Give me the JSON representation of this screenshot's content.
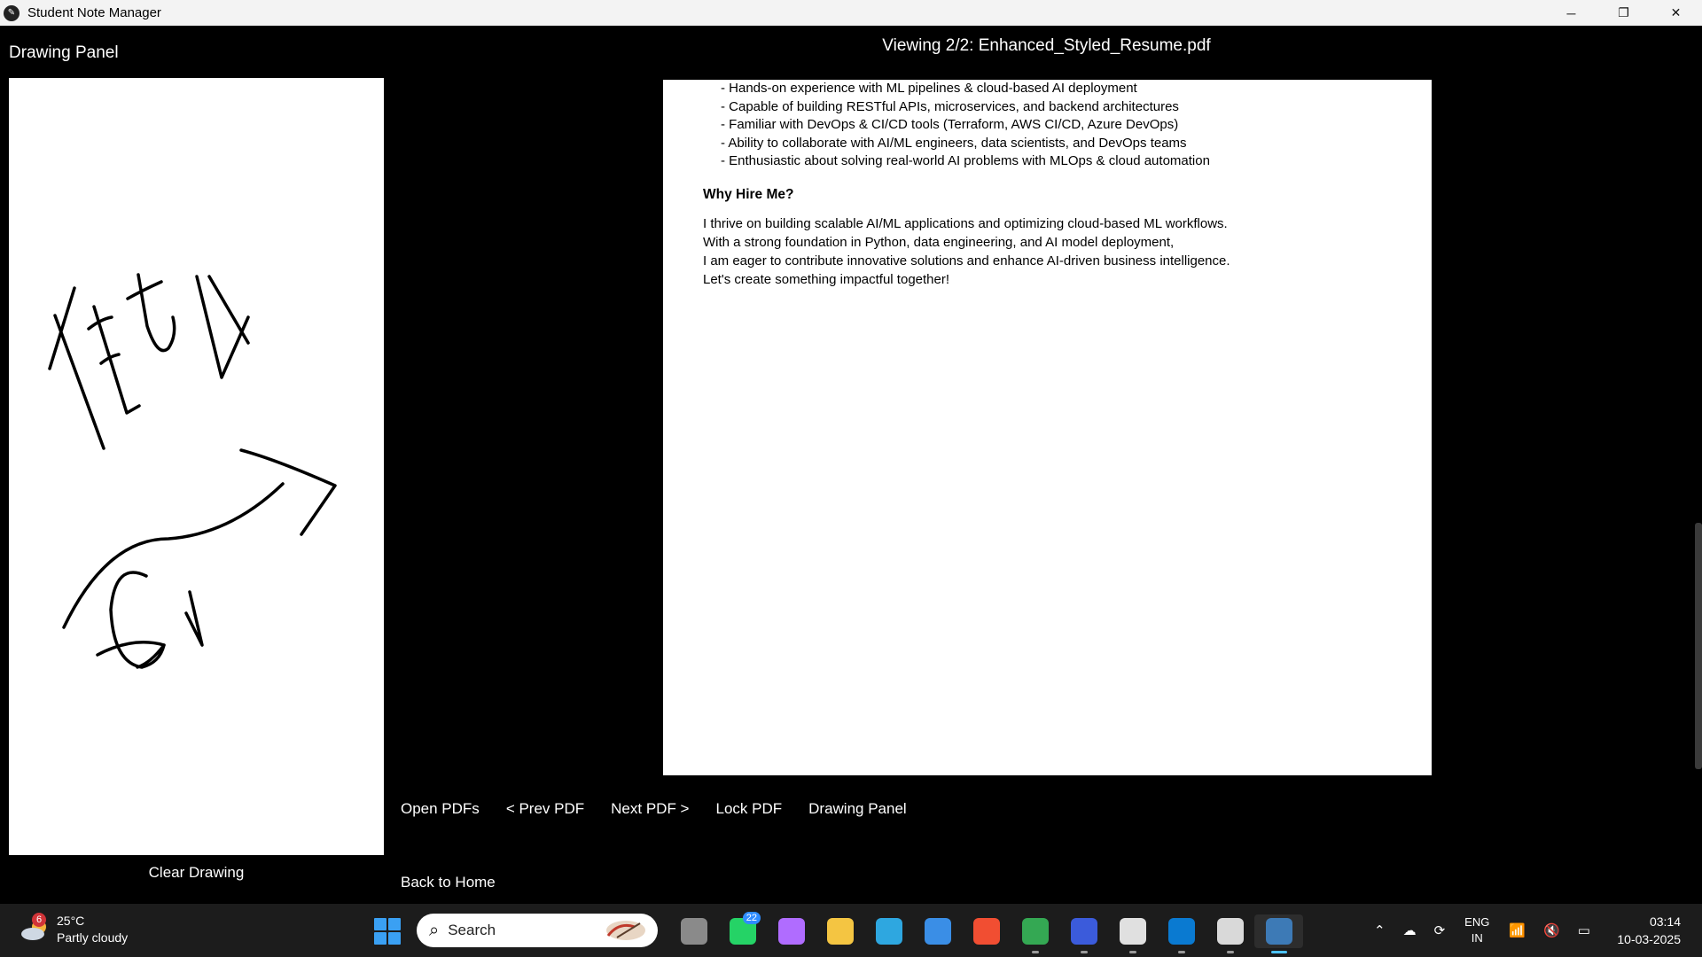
{
  "window": {
    "title": "Student Note Manager",
    "minimize_glyph": "─",
    "maximize_glyph": "❐",
    "close_glyph": "✕"
  },
  "drawing_panel": {
    "heading": "Drawing Panel",
    "clear_button": "Clear Drawing"
  },
  "viewer": {
    "status": "Viewing 2/2: Enhanced_Styled_Resume.pdf",
    "page": {
      "bullets": [
        "- Hands-on experience with ML pipelines & cloud-based AI deployment",
        "- Capable of building RESTful APIs, microservices, and backend architectures",
        "- Familiar with DevOps & CI/CD tools (Terraform, AWS CI/CD, Azure DevOps)",
        "- Ability to collaborate with AI/ML engineers, data scientists, and DevOps teams",
        "- Enthusiastic about solving real-world AI problems with MLOps & cloud automation"
      ],
      "section_heading": "Why Hire Me?",
      "paragraph": [
        "I thrive on building scalable AI/ML applications and optimizing cloud-based ML workflows.",
        "With a strong foundation in Python, data engineering, and AI model deployment,",
        "I am eager to contribute innovative solutions and enhance AI-driven business intelligence.",
        "Let's create something impactful together!"
      ]
    }
  },
  "toolbar": {
    "open_pdfs": "Open PDFs",
    "prev_pdf": "< Prev PDF",
    "next_pdf": "Next PDF >",
    "lock_pdf": "Lock PDF",
    "drawing_panel": "Drawing Panel",
    "back_home": "Back to Home"
  },
  "taskbar": {
    "weather": {
      "temp": "25°C",
      "condition": "Partly cloudy",
      "badge": "6"
    },
    "search_placeholder": "Search",
    "apps": [
      {
        "name": "task-view-icon",
        "color": "#8a8a8a",
        "badge": ""
      },
      {
        "name": "whatsapp-icon",
        "color": "#25d366",
        "badge": "22"
      },
      {
        "name": "copilot-icon",
        "color": "#b06cff",
        "badge": ""
      },
      {
        "name": "file-explorer-icon",
        "color": "#f4c542",
        "badge": ""
      },
      {
        "name": "edge-icon",
        "color": "#2ea7e0",
        "badge": ""
      },
      {
        "name": "microsoft-store-icon",
        "color": "#3a8ee6",
        "badge": ""
      },
      {
        "name": "git-icon",
        "color": "#f14e32",
        "badge": ""
      },
      {
        "name": "chrome-icon",
        "color": "#34a853",
        "badge": ""
      },
      {
        "name": "app-icon",
        "color": "#3b5bdb",
        "badge": ""
      },
      {
        "name": "chatgpt-icon",
        "color": "#e0e0e0",
        "badge": ""
      },
      {
        "name": "vscode-icon",
        "color": "#0a7ad1",
        "badge": ""
      },
      {
        "name": "snipping-tool-icon",
        "color": "#d9d9d9",
        "badge": ""
      },
      {
        "name": "python-icon",
        "color": "#3d7ab6",
        "badge": ""
      }
    ],
    "tray": {
      "language": "ENG",
      "region": "IN",
      "time": "03:14",
      "date": "10-03-2025"
    }
  }
}
